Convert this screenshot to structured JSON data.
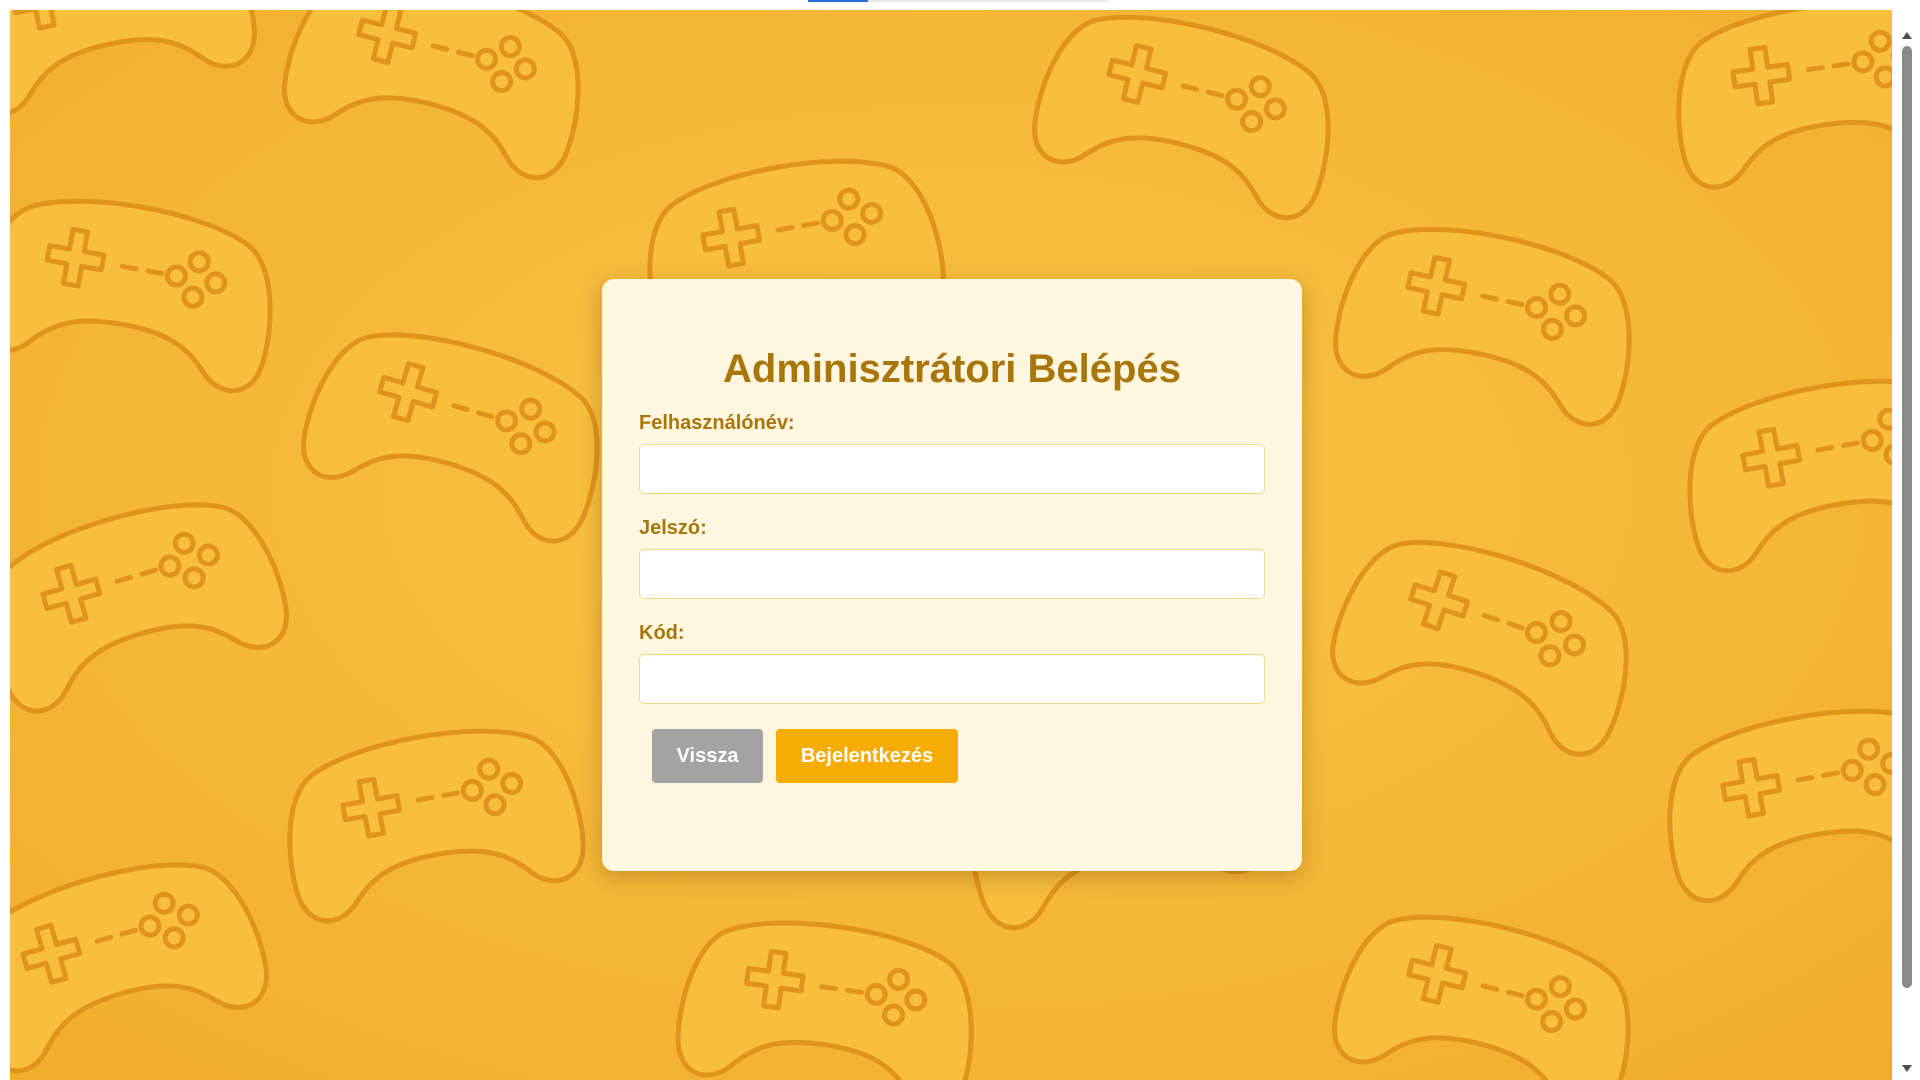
{
  "login": {
    "title": "Adminisztrátori Belépés",
    "username_label": "Felhasználónév:",
    "username_value": "",
    "password_label": "Jelszó:",
    "password_value": "",
    "code_label": "Kód:",
    "code_value": "",
    "back_button": "Vissza",
    "login_button": "Bejelentkezés"
  },
  "colors": {
    "background": "#f5b93a",
    "pattern_stroke": "#e0941c",
    "card": "#fff7df",
    "title": "#a8760a",
    "back_button": "#a3a3a3",
    "login_button": "#f6ac00"
  },
  "background": {
    "icon": "gamepad-icon"
  }
}
